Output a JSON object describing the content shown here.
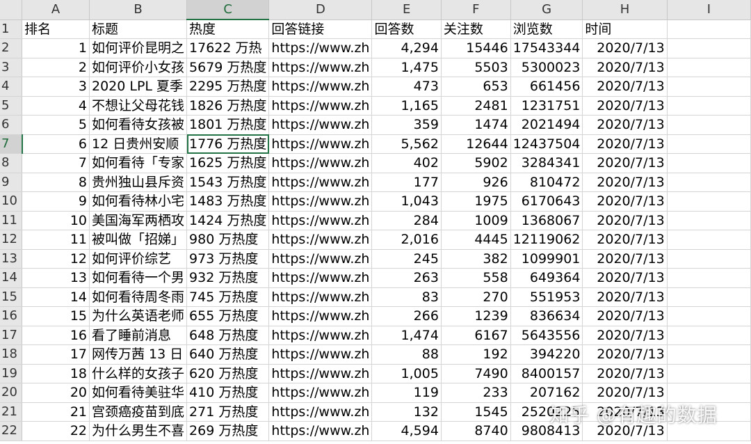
{
  "columns": [
    "A",
    "B",
    "C",
    "D",
    "E",
    "F",
    "G",
    "H",
    "I"
  ],
  "selected_column": "C",
  "selected_row": "7",
  "rows": [
    {
      "n": "1",
      "a": "排名",
      "b": "标题",
      "c": "热度",
      "d": "回答链接",
      "e": "回答数",
      "f": "关注数",
      "g": "浏览数",
      "h": "时间"
    },
    {
      "n": "2",
      "a": "1",
      "b": "如何评价昆明之",
      "c": "17622 万热",
      "d": "https://www.zh",
      "e": "4,294",
      "f": "15446",
      "g": "17543344",
      "h": "2020/7/13"
    },
    {
      "n": "3",
      "a": "2",
      "b": "如何评价小女孩",
      "c": "5679 万热度",
      "d": "https://www.zh",
      "e": "1,475",
      "f": "5503",
      "g": "5300023",
      "h": "2020/7/13"
    },
    {
      "n": "4",
      "a": "3",
      "b": "2020 LPL 夏季",
      "c": "2295 万热度",
      "d": "https://www.zh",
      "e": "473",
      "f": "653",
      "g": "661456",
      "h": "2020/7/13"
    },
    {
      "n": "5",
      "a": "4",
      "b": "不想让父母花钱",
      "c": "1826 万热度",
      "d": "https://www.zh",
      "e": "1,165",
      "f": "2481",
      "g": "1231751",
      "h": "2020/7/13"
    },
    {
      "n": "6",
      "a": "5",
      "b": "如何看待女孩被",
      "c": "1801 万热度",
      "d": "https://www.zh",
      "e": "359",
      "f": "1474",
      "g": "2021494",
      "h": "2020/7/13"
    },
    {
      "n": "7",
      "a": "6",
      "b": "12 日贵州安顺",
      "c": "1776 万热度",
      "d": "https://www.zh",
      "e": "5,562",
      "f": "12644",
      "g": "12437504",
      "h": "2020/7/13"
    },
    {
      "n": "8",
      "a": "7",
      "b": "如何看待「专家",
      "c": "1625 万热度",
      "d": "https://www.zh",
      "e": "402",
      "f": "5902",
      "g": "3284341",
      "h": "2020/7/13"
    },
    {
      "n": "9",
      "a": "8",
      "b": "贵州独山县斥资",
      "c": "1543 万热度",
      "d": "https://www.zh",
      "e": "177",
      "f": "926",
      "g": "810472",
      "h": "2020/7/13"
    },
    {
      "n": "10",
      "a": "9",
      "b": "如何看待林小宅",
      "c": "1483 万热度",
      "d": "https://www.zh",
      "e": "1,043",
      "f": "1975",
      "g": "6170643",
      "h": "2020/7/13"
    },
    {
      "n": "11",
      "a": "10",
      "b": "美国海军两栖攻",
      "c": "1424 万热度",
      "d": "https://www.zh",
      "e": "284",
      "f": "1009",
      "g": "1368067",
      "h": "2020/7/13"
    },
    {
      "n": "12",
      "a": "11",
      "b": "被叫做「招娣」",
      "c": "980 万热度",
      "d": "https://www.zh",
      "e": "2,016",
      "f": "4445",
      "g": "12119062",
      "h": "2020/7/13"
    },
    {
      "n": "13",
      "a": "12",
      "b": "如何评价综艺",
      "c": "973 万热度",
      "d": "https://www.zh",
      "e": "245",
      "f": "382",
      "g": "1099901",
      "h": "2020/7/13"
    },
    {
      "n": "14",
      "a": "13",
      "b": "如何看待一个男",
      "c": "932 万热度",
      "d": "https://www.zh",
      "e": "263",
      "f": "558",
      "g": "649364",
      "h": "2020/7/13"
    },
    {
      "n": "15",
      "a": "14",
      "b": "如何看待周冬雨",
      "c": "745 万热度",
      "d": "https://www.zh",
      "e": "83",
      "f": "270",
      "g": "551953",
      "h": "2020/7/13"
    },
    {
      "n": "16",
      "a": "15",
      "b": "为什么英语老师",
      "c": "655 万热度",
      "d": "https://www.zh",
      "e": "266",
      "f": "1239",
      "g": "836634",
      "h": "2020/7/13"
    },
    {
      "n": "17",
      "a": "16",
      "b": "看了睡前消息",
      "c": "648 万热度",
      "d": "https://www.zh",
      "e": "1,474",
      "f": "6167",
      "g": "5643556",
      "h": "2020/7/13"
    },
    {
      "n": "18",
      "a": "17",
      "b": "网传万茜 13 日",
      "c": "640 万热度",
      "d": "https://www.zh",
      "e": "88",
      "f": "192",
      "g": "394220",
      "h": "2020/7/13"
    },
    {
      "n": "19",
      "a": "18",
      "b": "什么样的女孩子",
      "c": "620 万热度",
      "d": "https://www.zh",
      "e": "1,005",
      "f": "7490",
      "g": "8400157",
      "h": "2020/7/13"
    },
    {
      "n": "20",
      "a": "20",
      "b": "如何看待美驻华",
      "c": "410 万热度",
      "d": "https://www.zh",
      "e": "119",
      "f": "233",
      "g": "207162",
      "h": "2020/7/13"
    },
    {
      "n": "21",
      "a": "21",
      "b": "宫颈癌疫苗到底",
      "c": "271 万热度",
      "d": "https://www.zh",
      "e": "132",
      "f": "1545",
      "g": "2520225",
      "h": "2020/7/13"
    },
    {
      "n": "22",
      "a": "22",
      "b": "为什么男生不喜",
      "c": "269 万热度",
      "d": "https://www.zh",
      "e": "4,594",
      "f": "8740",
      "g": "9808413",
      "h": "2020/7/13"
    }
  ],
  "watermark": "知乎 @有趣的数据"
}
